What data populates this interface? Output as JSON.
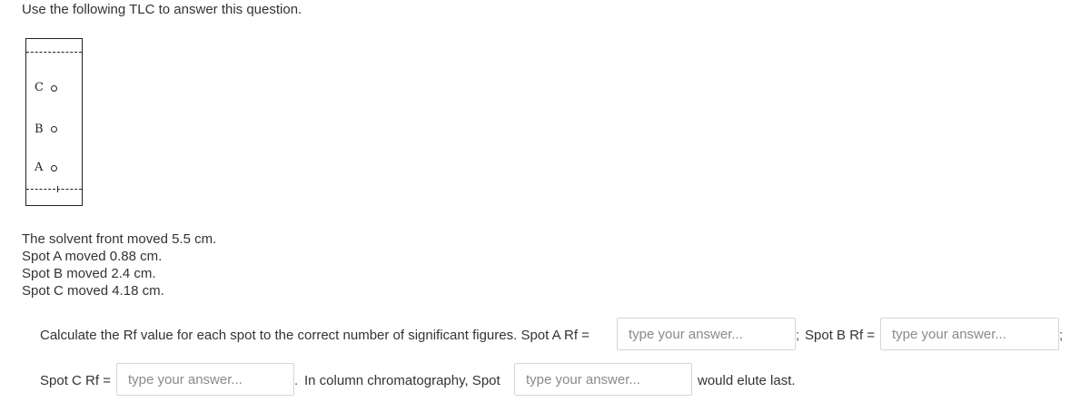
{
  "question": {
    "intro": "Use the following TLC to answer this question."
  },
  "tlc": {
    "spots": [
      {
        "label": "C"
      },
      {
        "label": "B"
      },
      {
        "label": "A"
      }
    ]
  },
  "info": {
    "lines": [
      "The solvent front moved 5.5 cm.",
      "Spot A moved 0.88 cm.",
      "Spot B moved 2.4 cm.",
      "Spot C moved 4.18 cm."
    ]
  },
  "prompt": {
    "calc_text": "Calculate the Rf value for each spot to the correct number of significant figures. Spot A Rf =",
    "spot_b_label": "Spot B Rf =",
    "spot_c_label": "Spot C Rf =",
    "column_text": "In column chromatography, Spot",
    "elute_text": "would elute last.",
    "separator_semicolon": ";",
    "separator_period": ".",
    "placeholder": "type your answer..."
  }
}
